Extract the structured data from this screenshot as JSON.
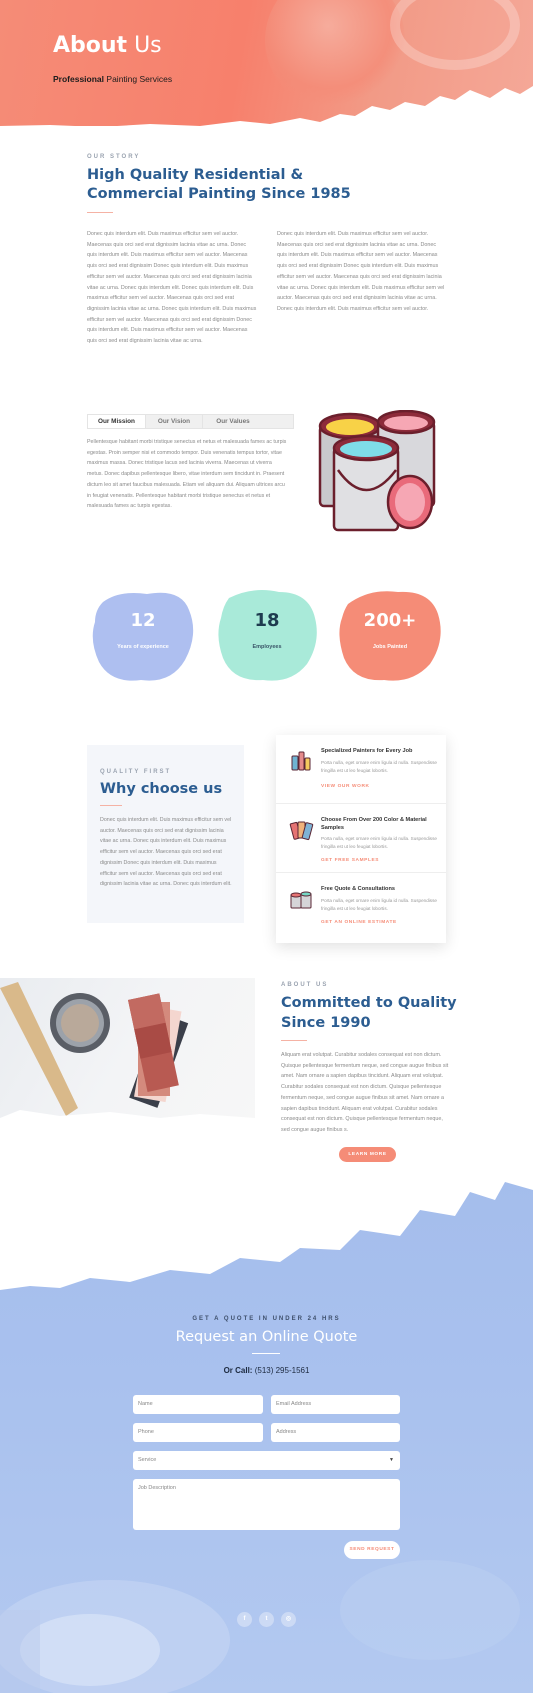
{
  "hero": {
    "title_bold": "About",
    "title_light": "Us",
    "subtitle_bold": "Professional",
    "subtitle_rest": "Painting Services"
  },
  "story": {
    "eyebrow": "OUR STORY",
    "title_line1": "High Quality Residential &",
    "title_line2": "Commercial Painting Since 1985",
    "col1": "Donec quis interdum elit. Duis maximus efficitur sem vel auctor. Maecenas quis orci sed erat dignissim lacinia vitae ac urna. Donec quis interdum elit. Duis maximus efficitur sem vel auctor. Maecenas quis orci sed erat dignissim Donec quis interdum elit. Duis maximus efficitur sem vel auctor. Maecenas quis orci sed erat dignissim lacinia vitae ac urna. Donec quis interdum elit. Donec quis interdum elit. Duis maximus efficitur sem vel auctor. Maecenas quis orci sed erat dignissim lacinia vitae ac urna. Donec quis interdum elit. Duis maximus efficitur sem vel auctor. Maecenas quis orci sed erat dignissim Donec quis interdum elit. Duis maximus efficitur sem vel auctor. Maecenas quis orci sed erat dignissim lacinia vitae ac urna.",
    "col2": "Donec quis interdum elit. Duis maximus efficitur sem vel auctor. Maecenas quis orci sed erat dignissim lacinia vitae ac urna. Donec quis interdum elit. Duis maximus efficitur sem vel auctor. Maecenas quis orci sed erat dignissim Donec quis interdum elit. Duis maximus efficitur sem vel auctor. Maecenas quis orci sed erat dignissim lacinia vitae ac urna. Donec quis interdum elit. Duis maximus efficitur sem vel auctor. Maecenas quis orci sed erat dignissim lacinia vitae ac urna. Donec quis interdum elit. Duis maximus efficitur sem vel auctor."
  },
  "tabs": {
    "items": [
      "Our Mission",
      "Our Vision",
      "Our Values"
    ],
    "active": "Our Mission",
    "content": "Pellentesque habitant morbi tristique senectus et netus et malesuada fames ac turpis egestas. Proin semper nisi et commodo tempor. Duis venenatis tempus tortor, vitae maximus massa. Donec tristique lacus sed lacinia viverra. Maecenas ut viverra metus. Donec dapibus pellentesque libero, vitae interdum sem tincidunt in. Praesent dictum leo sit amet faucibus malesuada. Etiam vel aliquam dui. Aliquam ultrices arcu in feugiat venenatis. Pellentesque habitant morbi tristique senectus et netus et malesuada fames ac turpis egestas."
  },
  "stats": [
    {
      "number": "12",
      "label": "Years of experience",
      "color": "#aebff0"
    },
    {
      "number": "18",
      "label": "Employees",
      "color": "#a9ead9"
    },
    {
      "number": "200+",
      "label": "Jobs Painted",
      "color": "#f58c77"
    }
  ],
  "why": {
    "eyebrow": "QUALITY FIRST",
    "title": "Why choose us",
    "text": "Donec quis interdum elit. Duis maximus efficitur sem vel auctor. Maecenas quis orci sed erat dignissim lacinia vitae ac urna. Donec quis interdum elit. Duis maximus efficitur sem vel auctor. Maecenas quis orci sed erat dignissim Donec quis interdum elit. Duis maximus efficitur sem vel auctor. Maecenas quis orci sed erat dignissim lacinia vitae ac urna. Donec quis interdum elit."
  },
  "features": [
    {
      "title": "Specialized Painters for Every Job",
      "text": "Porta nulla, eget ornare enim ligula id nulla. Suspendisse fringilla est ut leo feugiat lobortis.",
      "link": "VIEW OUR WORK",
      "icon": "painters-tools-icon"
    },
    {
      "title": "Choose From Over 200 Color & Material Samples",
      "text": "Porta nulla, eget ornare enim ligula id nulla. Suspendisse fringilla est ut leo feugiat lobortis.",
      "link": "GET FREE SAMPLES",
      "icon": "color-swatch-icon"
    },
    {
      "title": "Free Quote & Consultations",
      "text": "Porta nulla, eget ornare enim ligula id nulla. Suspendisse fringilla est ut leo feugiat lobortis.",
      "link": "GET AN ONLINE ESTIMATE",
      "icon": "paint-cans-icon"
    }
  ],
  "about": {
    "eyebrow": "ABOUT US",
    "title_line1": "Committed to Quality",
    "title_line2": "Since 1990",
    "text": "Aliquam erat volutpat. Curabitur sodales consequat est non dictum. Quisque pellentesque fermentum neque, sed congue augue finibus sit amet. Nam ornare a sapien dapibus tincidunt. Aliquam erat volutpat. Curabitur sodales consequat est non dictum. Quisque pellentesque fermentum neque, sed congue augue finibus sit amet. Nam ornare a sapien dapibus tincidunt. Aliquam erat volutpat. Curabitur sodales consequat est non dictum. Quisque pellentesque fermentum neque, sed congue augue finibus s.",
    "button": "LEARN MORE"
  },
  "quote": {
    "eyebrow": "GET A QUOTE IN UNDER 24 HRS",
    "title": "Request an Online Quote",
    "call_label": "Or Call:",
    "phone": "(513) 295-1561",
    "fields": {
      "name": "Name",
      "email": "Email Address",
      "phone": "Phone",
      "address": "Address",
      "service": "Service",
      "description": "Job Description"
    },
    "button": "SEND REQUEST"
  },
  "social": [
    {
      "label": "f",
      "icon": "facebook-icon"
    },
    {
      "label": "t",
      "icon": "twitter-icon"
    },
    {
      "label": "◎",
      "icon": "instagram-icon"
    }
  ],
  "colors": {
    "accent": "#f58c77",
    "heading": "#2c5d91",
    "quote_bg": "#a9c1ee"
  }
}
